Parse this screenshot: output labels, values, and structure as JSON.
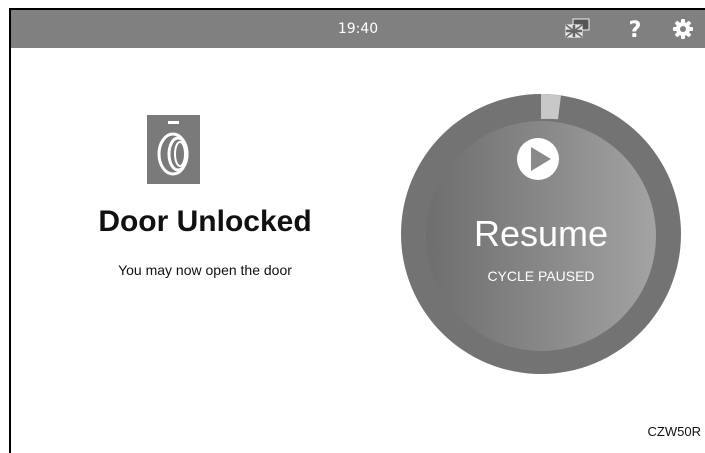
{
  "status_bar": {
    "time": "19:40",
    "icons": [
      "language-flag-icon",
      "help-icon",
      "settings-gear-icon"
    ],
    "bar_color": "#808080"
  },
  "door_status": {
    "icon": "door-unlocked-icon",
    "title": "Door Unlocked",
    "message": "You may now open the door"
  },
  "cycle_dial": {
    "action_label": "Resume",
    "state_label": "CYCLE PAUSED",
    "icon": "play-icon",
    "progress_fraction": 0.02
  },
  "model_code": "CZW50R"
}
